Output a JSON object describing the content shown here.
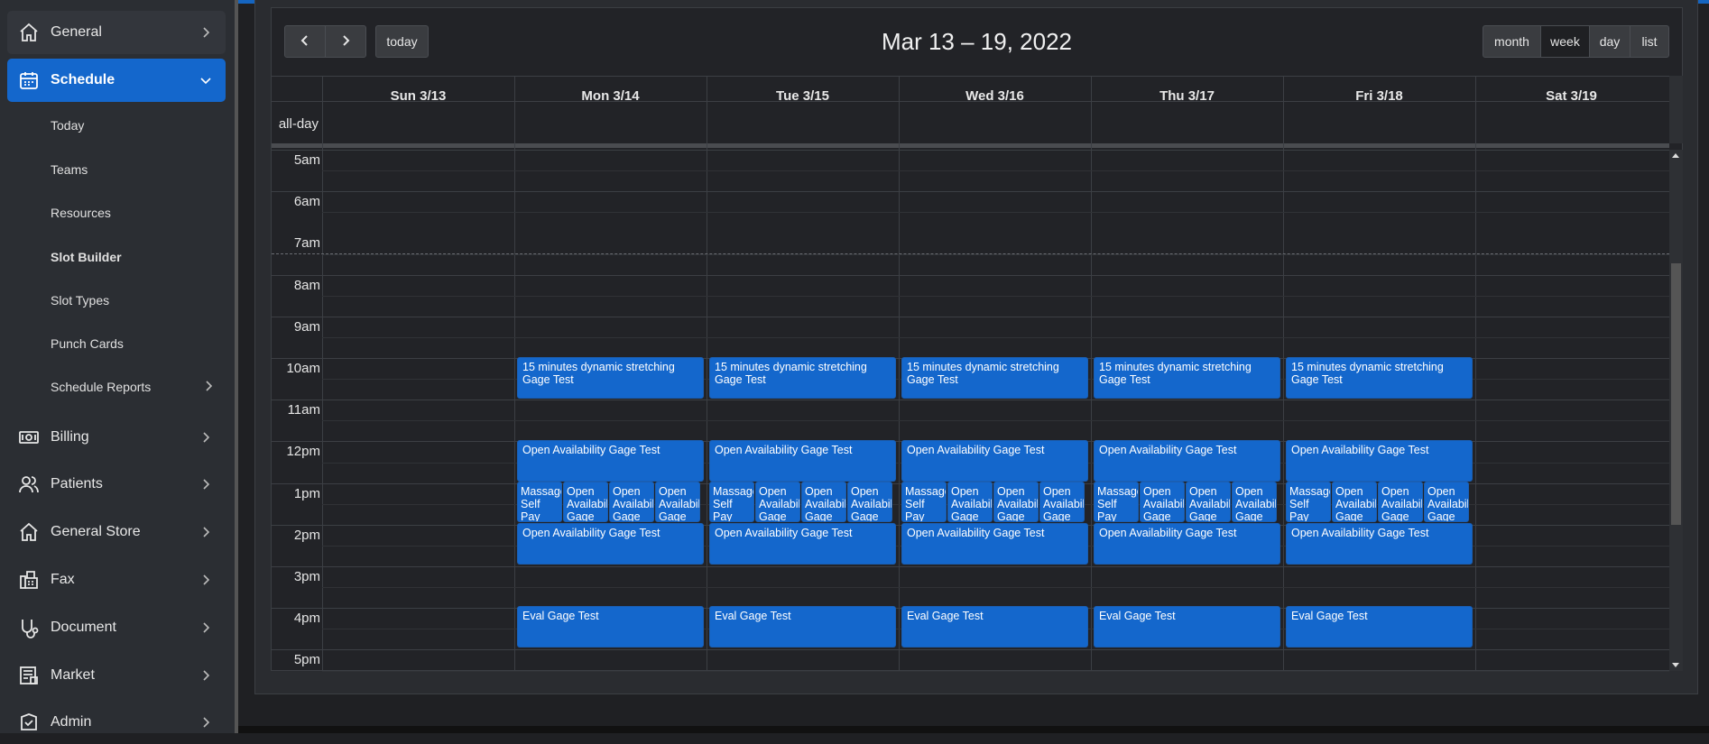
{
  "sidebar": {
    "items": [
      {
        "label": "General",
        "icon": "home-icon"
      },
      {
        "label": "Schedule",
        "icon": "calendar-icon"
      },
      {
        "label": "Billing",
        "icon": "money-icon"
      },
      {
        "label": "Patients",
        "icon": "users-icon"
      },
      {
        "label": "General Store",
        "icon": "store-icon"
      },
      {
        "label": "Fax",
        "icon": "fax-icon"
      },
      {
        "label": "Document",
        "icon": "document-icon"
      },
      {
        "label": "Market",
        "icon": "market-icon"
      },
      {
        "label": "Admin",
        "icon": "admin-icon"
      }
    ],
    "schedule_sub": [
      "Today",
      "Teams",
      "Resources",
      "Slot Builder",
      "Slot Types",
      "Punch Cards",
      "Schedule Reports"
    ]
  },
  "calendar": {
    "title": "Mar 13 – 19, 2022",
    "today_label": "today",
    "views": [
      "month",
      "week",
      "day",
      "list"
    ],
    "all_day_label": "all-day",
    "days": [
      "Sun 3/13",
      "Mon 3/14",
      "Tue 3/15",
      "Wed 3/16",
      "Thu 3/17",
      "Fri 3/18",
      "Sat 3/19"
    ],
    "times": [
      "5am",
      "6am",
      "7am",
      "8am",
      "9am",
      "10am",
      "11am",
      "12pm",
      "1pm",
      "2pm",
      "3pm",
      "4pm",
      "5pm"
    ],
    "events": {
      "stretch_line1": "15 minutes dynamic stretching",
      "stretch_line2": "Gage Test",
      "open": "Open Availability Gage Test",
      "massage": "Massage Self Pay",
      "open_short": "Open Availability Gage",
      "eval": "Eval Gage Test"
    }
  },
  "colors": {
    "accent": "#1467cc",
    "background": "#222327",
    "sidebar": "#2b2e33"
  }
}
